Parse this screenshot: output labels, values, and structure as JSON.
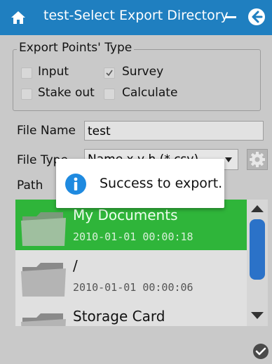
{
  "window": {
    "title": "test-Select Export Directory"
  },
  "export_points_type": {
    "legend": "Export Points' Type",
    "options": [
      {
        "label": "Input",
        "checked": false
      },
      {
        "label": "Survey",
        "checked": true
      },
      {
        "label": "Stake out",
        "checked": false
      },
      {
        "label": "Calculate",
        "checked": false
      }
    ]
  },
  "file_name": {
    "label": "File Name",
    "value": "test"
  },
  "file_type": {
    "label": "File Type",
    "selected": "Name,x,y,h (*.csv)"
  },
  "path": {
    "label": "Path"
  },
  "directory_list": [
    {
      "name": "My Documents",
      "date": "2010-01-01 00:00:18",
      "selected": true
    },
    {
      "name": "/",
      "date": "2010-01-01 00:00:06",
      "selected": false
    },
    {
      "name": "Storage Card",
      "date": "",
      "selected": false
    }
  ],
  "dialog": {
    "message": "Success to export."
  },
  "icons": [
    "home-icon",
    "minimize-icon",
    "back-icon",
    "gear-icon",
    "info-icon",
    "folder-icon",
    "scroll-up-icon",
    "scroll-down-icon",
    "ok-check-icon"
  ],
  "colors": {
    "titlebar": "#1f7fc0",
    "selection": "#2fb53a",
    "scroll_thumb": "#2b72c8",
    "background": "#c9c9c9"
  }
}
